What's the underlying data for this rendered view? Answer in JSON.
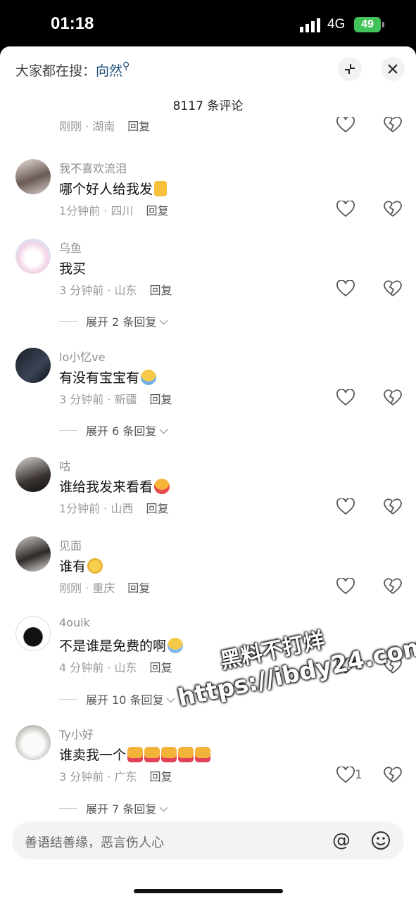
{
  "status_bar": {
    "time": "01:18",
    "network": "4G",
    "battery": "49"
  },
  "header": {
    "search_prefix": "大家都在搜：",
    "search_keyword": "向然",
    "comment_count": "8117 条评论"
  },
  "comments": [
    {
      "username": "",
      "content": "",
      "time_location": "刚刚 · 湖南",
      "reply_label": "回复",
      "likes": ""
    },
    {
      "username": "我不喜欢流泪",
      "content": "哪个好人给我发",
      "emoji": "crossed-fingers-emoji",
      "time_location": "1分钟前 · 四川",
      "reply_label": "回复",
      "likes": ""
    },
    {
      "username": "乌鱼",
      "content": "我买",
      "time_location": "3 分钟前 · 山东",
      "reply_label": "回复",
      "likes": ""
    },
    {
      "username": "lo小忆ve",
      "content": "有没有宝宝有",
      "emoji": "crying-emoji",
      "time_location": "3 分钟前 · 新疆",
      "reply_label": "回复",
      "likes": ""
    },
    {
      "username": "咕",
      "content": "谁给我发来看看",
      "emoji": "kissing-emoji",
      "time_location": "1分钟前 · 山西",
      "reply_label": "回复",
      "likes": ""
    },
    {
      "username": "见面",
      "content": "谁有",
      "emoji": "flushed-emoji",
      "time_location": "刚刚 · 重庆",
      "reply_label": "回复",
      "likes": ""
    },
    {
      "username": "4ouik",
      "content": "不是谁是免费的啊",
      "emoji": "laughing-crying-emoji",
      "time_location": "4 分钟前 · 山东",
      "reply_label": "回复",
      "likes": "2"
    },
    {
      "username": "Ty小好",
      "content": "谁卖我一个",
      "emoji": "nail-polish-emoji",
      "time_location": "3 分钟前 · 广东",
      "reply_label": "回复",
      "likes": "1"
    }
  ],
  "expand_replies": [
    "展开 2 条回复",
    "展开 6 条回复",
    "展开 10 条回复",
    "展开 7 条回复"
  ],
  "input": {
    "placeholder": "善语结善缘，恶言伤人心"
  },
  "watermark": {
    "line1": "黑料不打烊",
    "line2": "https://ibdy24.com"
  }
}
